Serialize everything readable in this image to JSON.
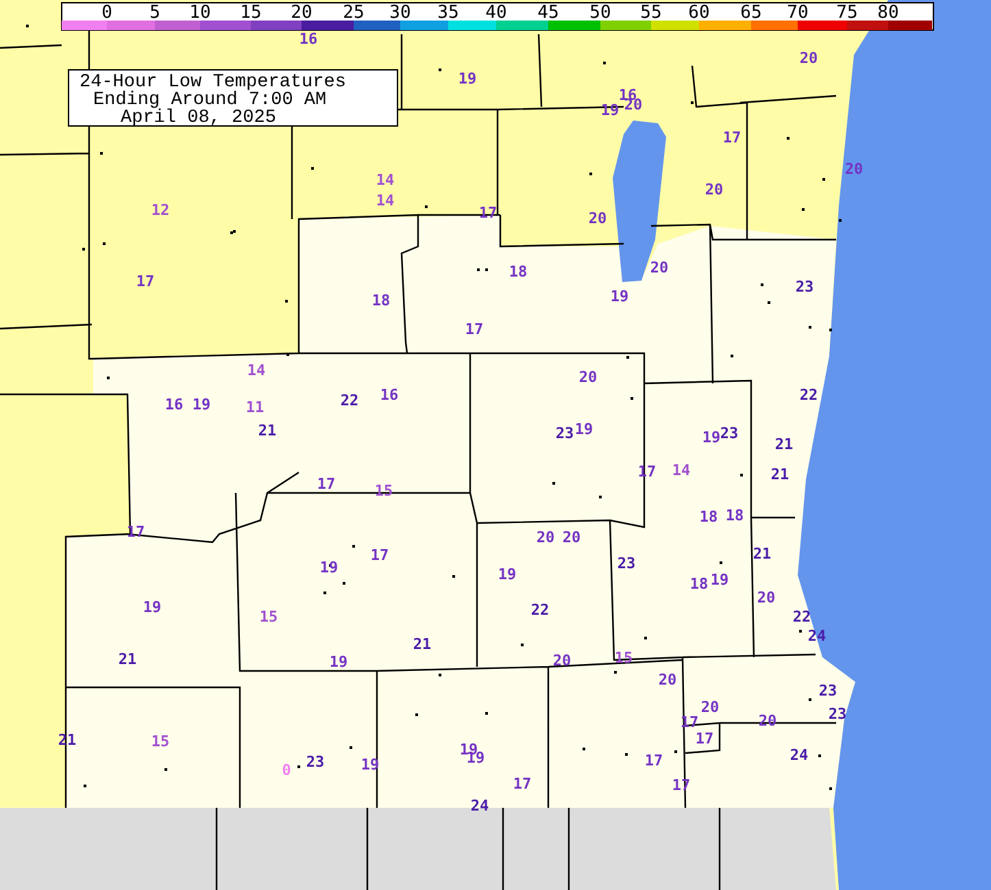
{
  "legend": {
    "ticks": [
      "0",
      "5",
      "10",
      "15",
      "20",
      "25",
      "30",
      "35",
      "40",
      "45",
      "50",
      "55",
      "60",
      "65",
      "70",
      "75",
      "80"
    ],
    "bins": [
      {
        "color": "#f080f0"
      },
      {
        "color": "#e070e0"
      },
      {
        "color": "#c060d0"
      },
      {
        "color": "#a050d0"
      },
      {
        "color": "#8040c0"
      },
      {
        "color": "#4a1ca0"
      },
      {
        "color": "#2060c0"
      },
      {
        "color": "#10a0e0"
      },
      {
        "color": "#00e0e0"
      },
      {
        "color": "#00d090"
      },
      {
        "color": "#00c000"
      },
      {
        "color": "#80d000"
      },
      {
        "color": "#d0e000"
      },
      {
        "color": "#ffb000"
      },
      {
        "color": "#ff7000"
      },
      {
        "color": "#ee0000"
      },
      {
        "color": "#c01010"
      },
      {
        "color": "#a00000"
      }
    ]
  },
  "title": {
    "lines": [
      "24-Hour Low Temperatures",
      "Ending Around 7:00 AM",
      "April 08, 2025"
    ]
  },
  "readings": [
    {
      "text": "16",
      "color": "#7433c4"
    },
    {
      "text": "19",
      "color": "#7433c4"
    },
    {
      "text": "16",
      "color": "#7433c4"
    },
    {
      "text": "19",
      "color": "#7433c4"
    },
    {
      "text": "20",
      "color": "#7433c4"
    },
    {
      "text": "20",
      "color": "#7433c4"
    },
    {
      "text": "17",
      "color": "#7433c4"
    },
    {
      "text": "20",
      "color": "#7433c4"
    },
    {
      "text": "20",
      "color": "#7433c4"
    },
    {
      "text": "12",
      "color": "#a050d0"
    },
    {
      "text": "14",
      "color": "#a050d0"
    },
    {
      "text": "14",
      "color": "#a050d0"
    },
    {
      "text": "17",
      "color": "#7433c4"
    },
    {
      "text": "20",
      "color": "#7433c4"
    },
    {
      "text": "17",
      "color": "#7433c4"
    },
    {
      "text": "18",
      "color": "#7433c4"
    },
    {
      "text": "20",
      "color": "#7433c4"
    },
    {
      "text": "18",
      "color": "#7433c4"
    },
    {
      "text": "19",
      "color": "#7433c4"
    },
    {
      "text": "23",
      "color": "#4a1ca8"
    },
    {
      "text": "17",
      "color": "#7433c4"
    },
    {
      "text": "14",
      "color": "#a050d0"
    },
    {
      "text": "20",
      "color": "#7433c4"
    },
    {
      "text": "16",
      "color": "#7433c4"
    },
    {
      "text": "19",
      "color": "#7433c4"
    },
    {
      "text": "11",
      "color": "#a050d0"
    },
    {
      "text": "22",
      "color": "#4a1ca8"
    },
    {
      "text": "16",
      "color": "#7433c4"
    },
    {
      "text": "21",
      "color": "#4a1ca8"
    },
    {
      "text": "22",
      "color": "#4a1ca8"
    },
    {
      "text": "23",
      "color": "#4a1ca8"
    },
    {
      "text": "19",
      "color": "#7433c4"
    },
    {
      "text": "19",
      "color": "#7433c4"
    },
    {
      "text": "23",
      "color": "#4a1ca8"
    },
    {
      "text": "21",
      "color": "#4a1ca8"
    },
    {
      "text": "17",
      "color": "#7433c4"
    },
    {
      "text": "14",
      "color": "#a050d0"
    },
    {
      "text": "21",
      "color": "#4a1ca8"
    },
    {
      "text": "17",
      "color": "#7433c4"
    },
    {
      "text": "15",
      "color": "#a050d0"
    },
    {
      "text": "18",
      "color": "#7433c4"
    },
    {
      "text": "18",
      "color": "#7433c4"
    },
    {
      "text": "17",
      "color": "#7433c4"
    },
    {
      "text": "20",
      "color": "#7433c4"
    },
    {
      "text": "20",
      "color": "#7433c4"
    },
    {
      "text": "23",
      "color": "#4a1ca8"
    },
    {
      "text": "21",
      "color": "#4a1ca8"
    },
    {
      "text": "19",
      "color": "#7433c4"
    },
    {
      "text": "17",
      "color": "#7433c4"
    },
    {
      "text": "19",
      "color": "#7433c4"
    },
    {
      "text": "18",
      "color": "#7433c4"
    },
    {
      "text": "19",
      "color": "#7433c4"
    },
    {
      "text": "20",
      "color": "#7433c4"
    },
    {
      "text": "19",
      "color": "#7433c4"
    },
    {
      "text": "22",
      "color": "#4a1ca8"
    },
    {
      "text": "15",
      "color": "#a050d0"
    },
    {
      "text": "22",
      "color": "#4a1ca8"
    },
    {
      "text": "24",
      "color": "#4a1ca8"
    },
    {
      "text": "21",
      "color": "#4a1ca8"
    },
    {
      "text": "21",
      "color": "#4a1ca8"
    },
    {
      "text": "19",
      "color": "#7433c4"
    },
    {
      "text": "20",
      "color": "#7433c4"
    },
    {
      "text": "15",
      "color": "#a050d0"
    },
    {
      "text": "20",
      "color": "#7433c4"
    },
    {
      "text": "23",
      "color": "#4a1ca8"
    },
    {
      "text": "20",
      "color": "#7433c4"
    },
    {
      "text": "23",
      "color": "#4a1ca8"
    },
    {
      "text": "17",
      "color": "#7433c4"
    },
    {
      "text": "20",
      "color": "#7433c4"
    },
    {
      "text": "21",
      "color": "#4a1ca8"
    },
    {
      "text": "15",
      "color": "#a050d0"
    },
    {
      "text": "19",
      "color": "#7433c4"
    },
    {
      "text": "17",
      "color": "#7433c4"
    },
    {
      "text": "19",
      "color": "#7433c4"
    },
    {
      "text": "24",
      "color": "#4a1ca8"
    },
    {
      "text": "0",
      "color": "#f080f0"
    },
    {
      "text": "23",
      "color": "#4a1ca8"
    },
    {
      "text": "19",
      "color": "#7433c4"
    },
    {
      "text": "17",
      "color": "#7433c4"
    },
    {
      "text": "17",
      "color": "#7433c4"
    },
    {
      "text": "17",
      "color": "#7433c4"
    },
    {
      "text": "24",
      "color": "#4a1ca8"
    }
  ]
}
